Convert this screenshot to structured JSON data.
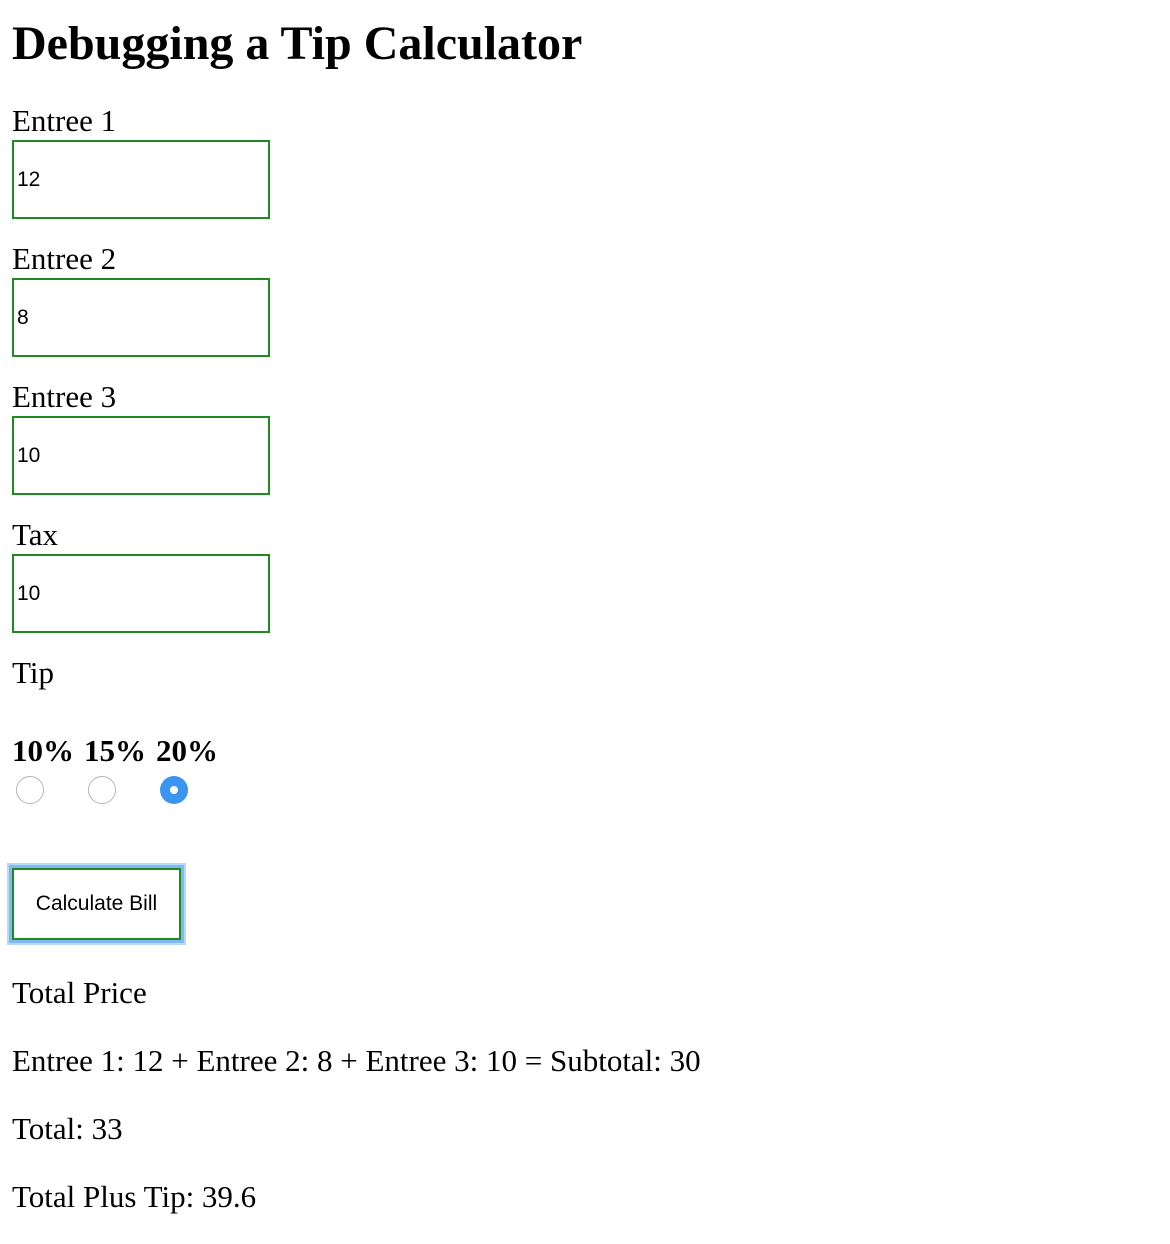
{
  "page": {
    "title": "Debugging a Tip Calculator"
  },
  "form": {
    "entree1": {
      "label": "Entree 1",
      "value": "12"
    },
    "entree2": {
      "label": "Entree 2",
      "value": "8"
    },
    "entree3": {
      "label": "Entree 3",
      "value": "10"
    },
    "tax": {
      "label": "Tax",
      "value": "10"
    },
    "tip": {
      "label": "Tip",
      "options": [
        {
          "label": "10%",
          "selected": false
        },
        {
          "label": "15%",
          "selected": false
        },
        {
          "label": "20%",
          "selected": true
        }
      ]
    },
    "calculate_button": "Calculate Bill"
  },
  "results": {
    "heading": "Total Price",
    "subtotal_line": "Entree 1: 12 + Entree 2: 8 + Entree 3: 10 = Subtotal: 30",
    "total_line": "Total: 33",
    "total_plus_tip_line": "Total Plus Tip: 39.6"
  },
  "colors": {
    "input_border": "#1f8a1f",
    "radio_selected": "#3b95f0",
    "focus_ring": "#7fb9f5"
  }
}
